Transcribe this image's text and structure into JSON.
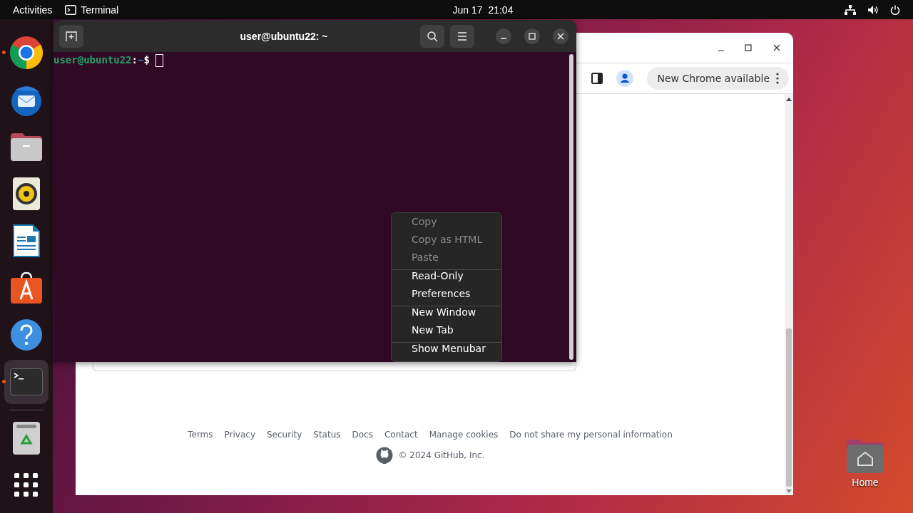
{
  "top_bar": {
    "activities": "Activities",
    "app_name": "Terminal",
    "clock": "Jun 17  21:04"
  },
  "dock": {
    "items": [
      {
        "kind": "chrome",
        "running": true,
        "selected": false
      },
      {
        "kind": "thunderbird",
        "running": false,
        "selected": false
      },
      {
        "kind": "files",
        "running": false,
        "selected": false
      },
      {
        "kind": "rhythmbox",
        "running": false,
        "selected": false
      },
      {
        "kind": "writer",
        "running": false,
        "selected": false
      },
      {
        "kind": "appcenter",
        "running": false,
        "selected": false
      },
      {
        "kind": "help",
        "running": false,
        "selected": false
      },
      {
        "kind": "terminal",
        "running": true,
        "selected": true
      }
    ],
    "bottom_items": [
      {
        "kind": "trash"
      },
      {
        "kind": "apps"
      }
    ]
  },
  "chrome": {
    "update_button": "New Chrome available",
    "footer_links": [
      "Terms",
      "Privacy",
      "Security",
      "Status",
      "Docs",
      "Contact",
      "Manage cookies",
      "Do not share my personal information"
    ],
    "copyright": "© 2024 GitHub, Inc."
  },
  "terminal": {
    "title": "user@ubuntu22: ~",
    "prompt_user": "user@ubuntu22",
    "prompt_sep": ":",
    "prompt_path": "~",
    "prompt_symbol": "$"
  },
  "context_menu": {
    "groups": [
      [
        {
          "label": "Copy",
          "disabled": true
        },
        {
          "label": "Copy as HTML",
          "disabled": true
        },
        {
          "label": "Paste",
          "disabled": true
        }
      ],
      [
        {
          "label": "Read-Only",
          "disabled": false
        },
        {
          "label": "Preferences",
          "disabled": false
        }
      ],
      [
        {
          "label": "New Window",
          "disabled": false
        },
        {
          "label": "New Tab",
          "disabled": false
        }
      ],
      [
        {
          "label": "Show Menubar",
          "disabled": false
        }
      ]
    ]
  },
  "desktop_icons": [
    {
      "label": "Home"
    }
  ]
}
